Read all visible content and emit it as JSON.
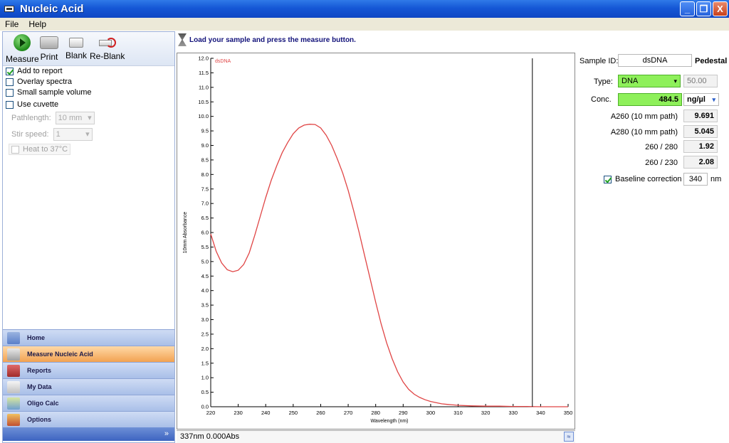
{
  "window": {
    "title": "Nucleic Acid",
    "min": "_",
    "max": "❐",
    "close": "X"
  },
  "menu": [
    "File",
    "Help"
  ],
  "toolbar": {
    "measure": "Measure",
    "print": "Print",
    "blank": "Blank",
    "reblank": "Re-Blank"
  },
  "options": {
    "add_to_report": "Add to report",
    "overlay_spectra": "Overlay spectra",
    "small_sample_volume": "Small sample volume",
    "use_cuvette": "Use cuvette",
    "pathlength_label": "Pathlength:",
    "pathlength_value": "10 mm",
    "stir_speed_label": "Stir speed:",
    "stir_speed_value": "1",
    "heat_label": "Heat to 37°C"
  },
  "nav": [
    {
      "label": "Home"
    },
    {
      "label": "Measure Nucleic Acid"
    },
    {
      "label": "Reports"
    },
    {
      "label": "My Data"
    },
    {
      "label": "Oligo Calc"
    },
    {
      "label": "Options"
    }
  ],
  "nav_footer": "»",
  "header_message": "Load your sample and press the measure button.",
  "status": "337nm 0.000Abs",
  "collapse_label": "≈",
  "chart_data": {
    "type": "line",
    "series": [
      {
        "name": "dsDNA",
        "color": "#e04545",
        "x": [
          220,
          222,
          224,
          226,
          228,
          230,
          232,
          234,
          236,
          238,
          240,
          242,
          244,
          246,
          248,
          250,
          252,
          254,
          256,
          258,
          260,
          262,
          264,
          266,
          268,
          270,
          272,
          274,
          276,
          278,
          280,
          282,
          284,
          286,
          288,
          290,
          292,
          294,
          296,
          298,
          300,
          302,
          304,
          306,
          310,
          315,
          320,
          325,
          330,
          335,
          340,
          345,
          350
        ],
        "y": [
          5.95,
          5.35,
          4.95,
          4.72,
          4.65,
          4.7,
          4.9,
          5.3,
          5.9,
          6.55,
          7.2,
          7.8,
          8.3,
          8.75,
          9.1,
          9.4,
          9.6,
          9.7,
          9.73,
          9.72,
          9.6,
          9.35,
          9.0,
          8.55,
          8.05,
          7.45,
          6.75,
          6.0,
          5.2,
          4.4,
          3.6,
          2.85,
          2.2,
          1.65,
          1.2,
          0.85,
          0.6,
          0.43,
          0.32,
          0.24,
          0.18,
          0.14,
          0.1,
          0.08,
          0.05,
          0.03,
          0.02,
          0.02,
          0.01,
          0.01,
          0.0,
          0.0,
          0.0
        ]
      }
    ],
    "xlabel": "Wavelength (nm)",
    "ylabel": "10mm Absorbance",
    "xlim": [
      220,
      350
    ],
    "ylim": [
      0,
      12
    ],
    "xticks": [
      "220",
      "230",
      "240",
      "250",
      "260",
      "270",
      "280",
      "290",
      "300",
      "310",
      "320",
      "330",
      "340",
      "350"
    ],
    "yticks": [
      "0.0",
      "0.5",
      "1.0",
      "1.5",
      "2.0",
      "2.5",
      "3.0",
      "3.5",
      "4.0",
      "4.5",
      "5.0",
      "5.5",
      "6.0",
      "6.5",
      "7.0",
      "7.5",
      "8.0",
      "8.5",
      "9.0",
      "9.5",
      "10.0",
      "10.5",
      "11.0",
      "11.5",
      "12.0"
    ],
    "cursor_x": 337,
    "grid": false
  },
  "right_panel": {
    "sample_id_label": "Sample ID:",
    "sample_id_value": "dsDNA",
    "mode": "Pedestal",
    "type_label": "Type:",
    "type_value": "DNA",
    "type_factor": "50.00",
    "conc_label": "Conc.",
    "conc_value": "484.5",
    "conc_unit": "ng/µl",
    "a260_label": "A260 (10 mm path)",
    "a260_value": "9.691",
    "a280_label": "A280 (10 mm path)",
    "a280_value": "5.045",
    "r260_280_label": "260 / 280",
    "r260_280_value": "1.92",
    "r260_230_label": "260 / 230",
    "r260_230_value": "2.08",
    "baseline_label": "Baseline correction",
    "baseline_value": "340",
    "baseline_unit": "nm"
  },
  "colors": {
    "title_bar": "#1557d6",
    "active_nav": "#f2a251",
    "curve": "#e04545",
    "type_highlight": "#8ef05a"
  }
}
